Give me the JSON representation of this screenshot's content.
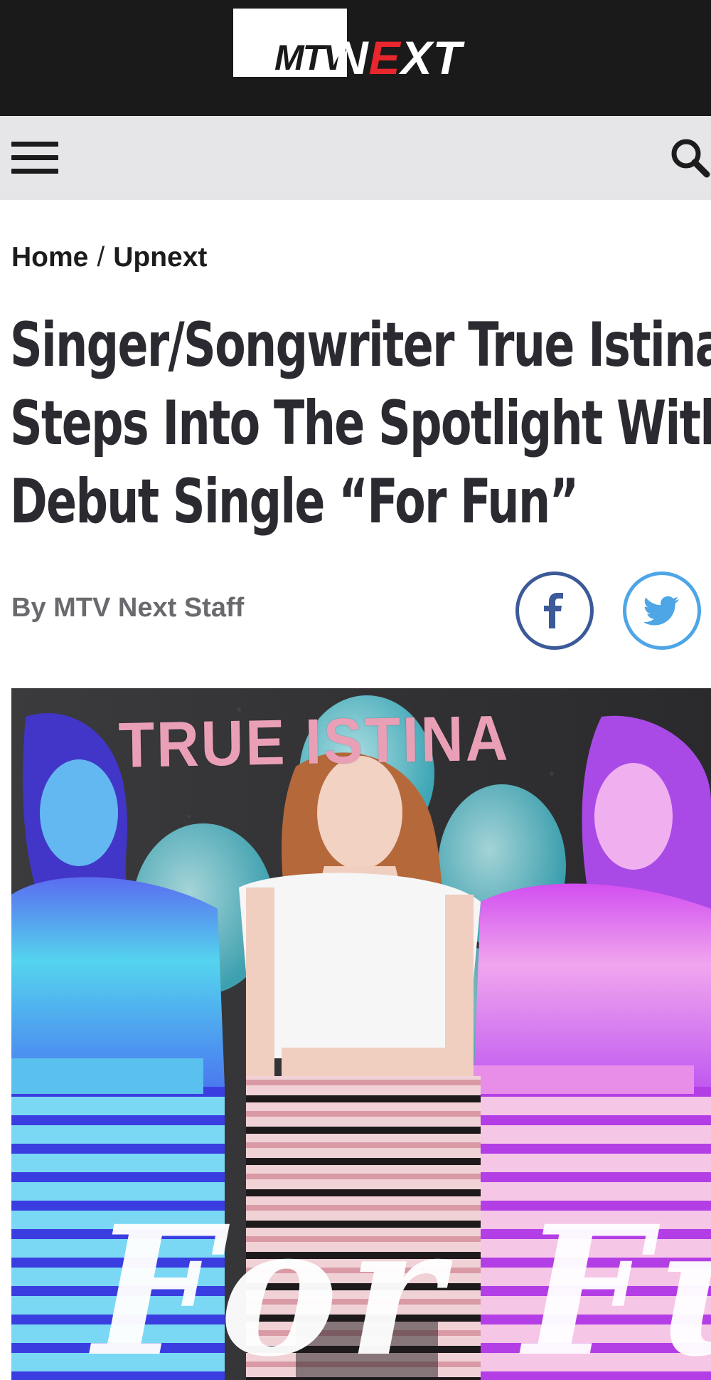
{
  "header": {
    "logo_text_mtv": "MTV",
    "logo_text_next_a": "N",
    "logo_text_next_e": "E",
    "logo_text_next_b": "XT",
    "background": "#1a1a1a",
    "accent": "#e8262d"
  },
  "navbar": {
    "menu_icon": "hamburger-menu-icon",
    "search_icon": "search-icon",
    "background": "#e6e5e8"
  },
  "breadcrumb": {
    "home": "Home",
    "separator": "/",
    "section": "Upnext"
  },
  "article": {
    "headline_lines": [
      "Singer/Songwriter True Istina",
      "Steps Into The Spotlight With",
      "Debut Single “For Fun”"
    ],
    "byline": "By MTV Next Staff"
  },
  "share": {
    "facebook_icon": "facebook-icon",
    "twitter_icon": "twitter-icon",
    "facebook_color": "#3c5a99",
    "twitter_color": "#4ea6e6"
  },
  "hero": {
    "title": "TRUE ISTINA",
    "subtitle": "For Fun"
  }
}
